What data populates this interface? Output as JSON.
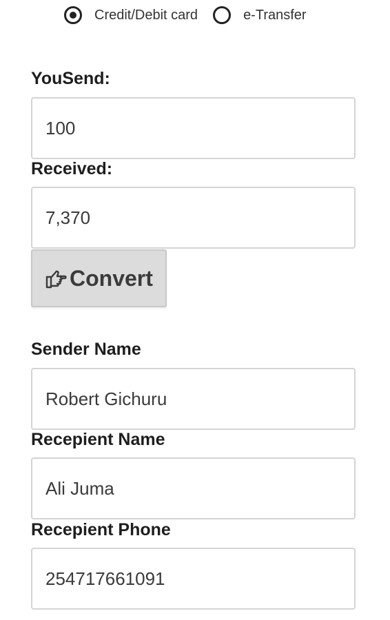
{
  "payment_methods": {
    "options": [
      {
        "label": "Credit/Debit card",
        "selected": true
      },
      {
        "label": "e-Transfer",
        "selected": false
      }
    ]
  },
  "form": {
    "you_send": {
      "label": "YouSend:",
      "value": "100"
    },
    "received": {
      "label": "Received:",
      "value": "7,370"
    },
    "convert_button": {
      "label": "Convert",
      "icon": "hand-pointer-icon"
    },
    "sender_name": {
      "label": "Sender Name",
      "value": "Robert Gichuru"
    },
    "recipient_name": {
      "label": "Recepient Name",
      "value": "Ali Juma"
    },
    "recipient_phone": {
      "label": "Recepient Phone",
      "value": "254717661091"
    }
  },
  "colors": {
    "text": "#222222",
    "input_border": "#d4d4d4",
    "button_bg": "#dcdcdc"
  }
}
